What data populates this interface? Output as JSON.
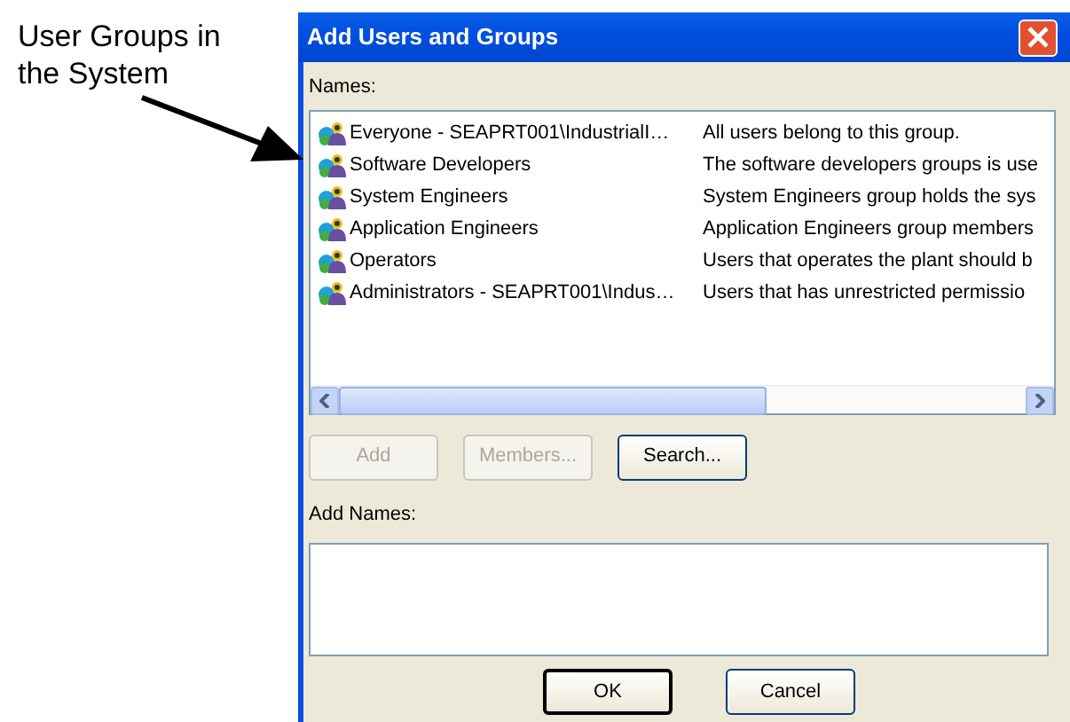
{
  "annotation": {
    "text": "User Groups in the System"
  },
  "window": {
    "title": "Add Users and Groups"
  },
  "names_label": "Names:",
  "groups": [
    {
      "name": "Everyone - SEAPRT001\\IndustrialI…",
      "description": "All users belong to this group."
    },
    {
      "name": "Software Developers",
      "description": "The software developers groups is use"
    },
    {
      "name": "System Engineers",
      "description": "System Engineers group holds the sys"
    },
    {
      "name": "Application Engineers",
      "description": "Application Engineers group members"
    },
    {
      "name": "Operators",
      "description": "Users that operates the plant should b"
    },
    {
      "name": "Administrators - SEAPRT001\\Indus…",
      "description": "Users that has unrestricted permissio"
    }
  ],
  "buttons": [
    {
      "label": "Add",
      "disabled": true
    },
    {
      "label": "Members...",
      "disabled": true
    },
    {
      "label": "Search...",
      "disabled": false
    }
  ],
  "add_names_label": "Add Names:",
  "dialog_buttons": [
    {
      "label": "OK",
      "default": true
    },
    {
      "label": "Cancel",
      "default": false
    }
  ]
}
